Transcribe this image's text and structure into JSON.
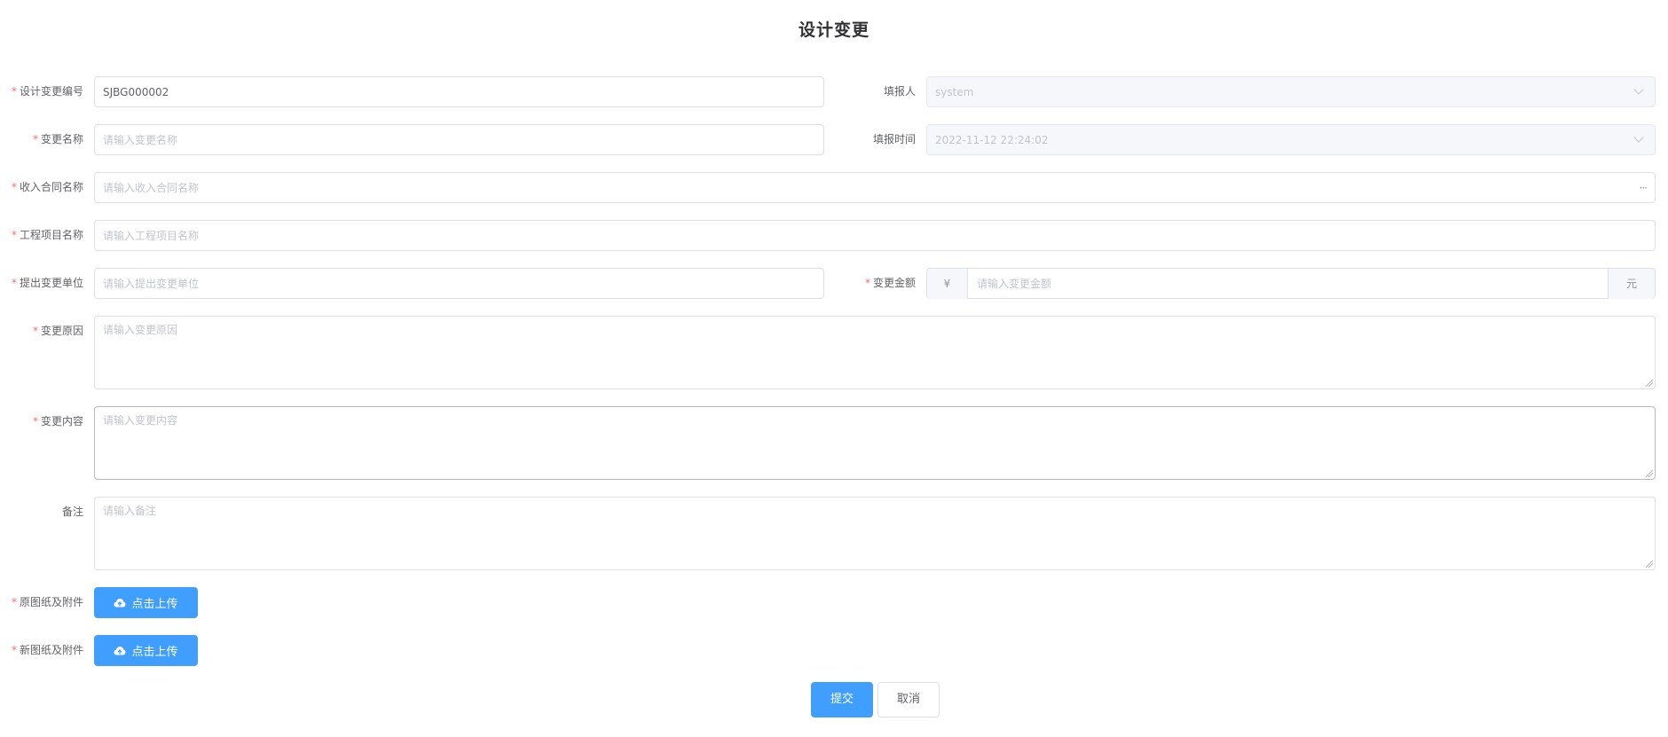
{
  "page": {
    "title": "设计变更"
  },
  "fields": {
    "change_no": {
      "label": "设计变更编号",
      "required": "*",
      "value": "SJBG000002"
    },
    "reporter": {
      "label": "填报人",
      "value": "system"
    },
    "change_name": {
      "label": "变更名称",
      "required": "*",
      "placeholder": "请输入变更名称"
    },
    "report_time": {
      "label": "填报时间",
      "value": "2022-11-12 22:24:02"
    },
    "contract_name": {
      "label": "收入合同名称",
      "required": "*",
      "placeholder": "请输入收入合同名称",
      "more_icon": "···"
    },
    "project_name": {
      "label": "工程项目名称",
      "required": "*",
      "placeholder": "请输入工程项目名称"
    },
    "proposer_unit": {
      "label": "提出变更单位",
      "required": "*",
      "placeholder": "请输入提出变更单位"
    },
    "change_amount": {
      "label": "变更金额",
      "required": "*",
      "prefix": "¥",
      "placeholder": "请输入变更金额",
      "suffix": "元"
    },
    "change_reason": {
      "label": "变更原因",
      "required": "*",
      "placeholder": "请输入变更原因"
    },
    "change_content": {
      "label": "变更内容",
      "required": "*",
      "placeholder": "请输入变更内容"
    },
    "remark": {
      "label": "备注",
      "placeholder": "请输入备注"
    },
    "original_drawings": {
      "label": "原图纸及附件",
      "required": "*",
      "button": "点击上传"
    },
    "new_drawings": {
      "label": "新图纸及附件",
      "required": "*",
      "button": "点击上传"
    }
  },
  "actions": {
    "submit": "提交",
    "cancel": "取消"
  },
  "colors": {
    "primary": "#409eff",
    "required": "#f56c6c",
    "border": "#dcdfe6",
    "disabled_bg": "#f5f7fa"
  }
}
